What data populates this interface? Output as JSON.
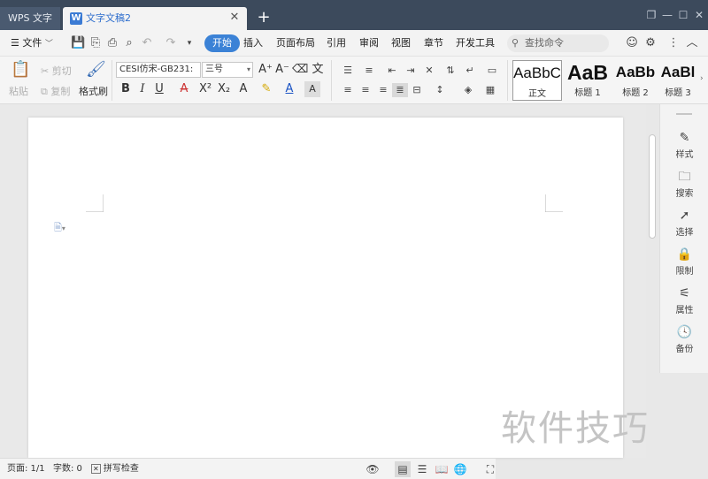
{
  "titlebar": {
    "app_tab": "WPS 文字",
    "doc_tab": "文字文稿2",
    "new_tab": "+"
  },
  "menubar": {
    "file_menu": "文件",
    "tabs": [
      "开始",
      "插入",
      "页面布局",
      "引用",
      "审阅",
      "视图",
      "章节",
      "开发工具"
    ],
    "active_tab": "开始",
    "search_placeholder": "查找命令"
  },
  "ribbon": {
    "clipboard": {
      "paste": "粘贴",
      "cut": "剪切",
      "copy": "复制",
      "format_painter": "格式刷"
    },
    "font_name": "CESI仿宋-GB231:",
    "font_size": "三号",
    "styles": [
      {
        "sample": "AaBbC",
        "name": "正文"
      },
      {
        "sample": "AaB",
        "name": "标题 1"
      },
      {
        "sample": "AaBb",
        "name": "标题 2"
      },
      {
        "sample": "AaBl",
        "name": "标题 3"
      }
    ]
  },
  "side_panel": {
    "items": [
      "样式",
      "搜索",
      "选择",
      "限制",
      "属性",
      "备份"
    ]
  },
  "statusbar": {
    "page": "页面: 1/1",
    "words": "字数: 0",
    "spellcheck": "拼写检查"
  },
  "watermark": "软件技巧",
  "colors": {
    "accent": "#3b82d6",
    "titlebar": "#3c4a5c"
  }
}
